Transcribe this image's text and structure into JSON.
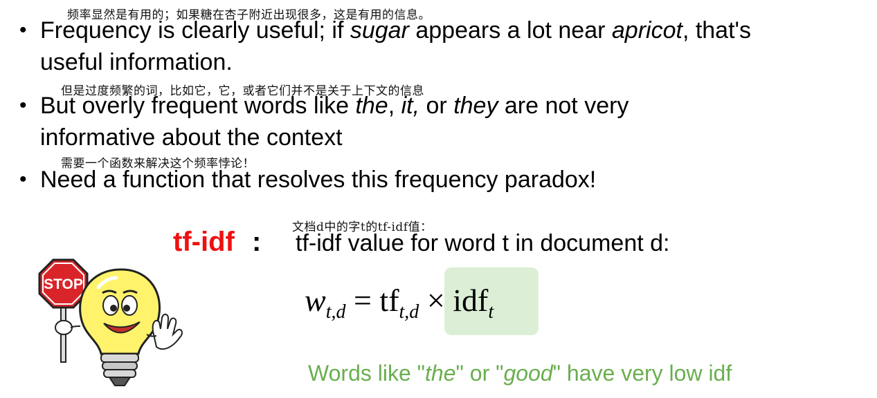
{
  "bullets": [
    {
      "annotation_zh": "频率显然是有用的；如果糖在杏子附近出现很多，这是有用的信息。",
      "line1_a": "Frequency is clearly useful; if ",
      "line1_em1": "sugar",
      "line1_b": " appears a lot near ",
      "line1_em2": "apricot",
      "line1_c": ", that's",
      "line2": "useful information."
    },
    {
      "annotation_zh": "但是过度频繁的词，比如它，它，或者它们并不是关于上下文的信息",
      "line1_a": "But overly frequent words like ",
      "line1_em1": "the",
      "line1_b": ", ",
      "line1_em2": "it,",
      "line1_c": " or ",
      "line1_em3": "they",
      "line1_d": " are not very",
      "line2": "informative about the context"
    },
    {
      "annotation_zh": "需要一个函数来解决这个频率悖论！",
      "line1": "Need a function that resolves this frequency paradox!"
    }
  ],
  "tfidf": {
    "label": "tf-idf",
    "colon": ":",
    "annotation_zh": "文档d中的字t的tf-idf值：",
    "description": "tf-idf value for word t in document d:"
  },
  "formula": {
    "w": "w",
    "w_sub": "t,d",
    "equals": " = ",
    "tf": "tf",
    "tf_sub": "t,d",
    "times": " × ",
    "idf": "idf",
    "idf_sub": "t"
  },
  "note": {
    "a": "Words like \"",
    "em1": "the",
    "b": "\" or \"",
    "em2": "good",
    "c": "\" have very low idf"
  },
  "illustration": {
    "sign_text": "STOP",
    "sign_color": "#d9252a",
    "bulb_color": "#fff36b"
  }
}
